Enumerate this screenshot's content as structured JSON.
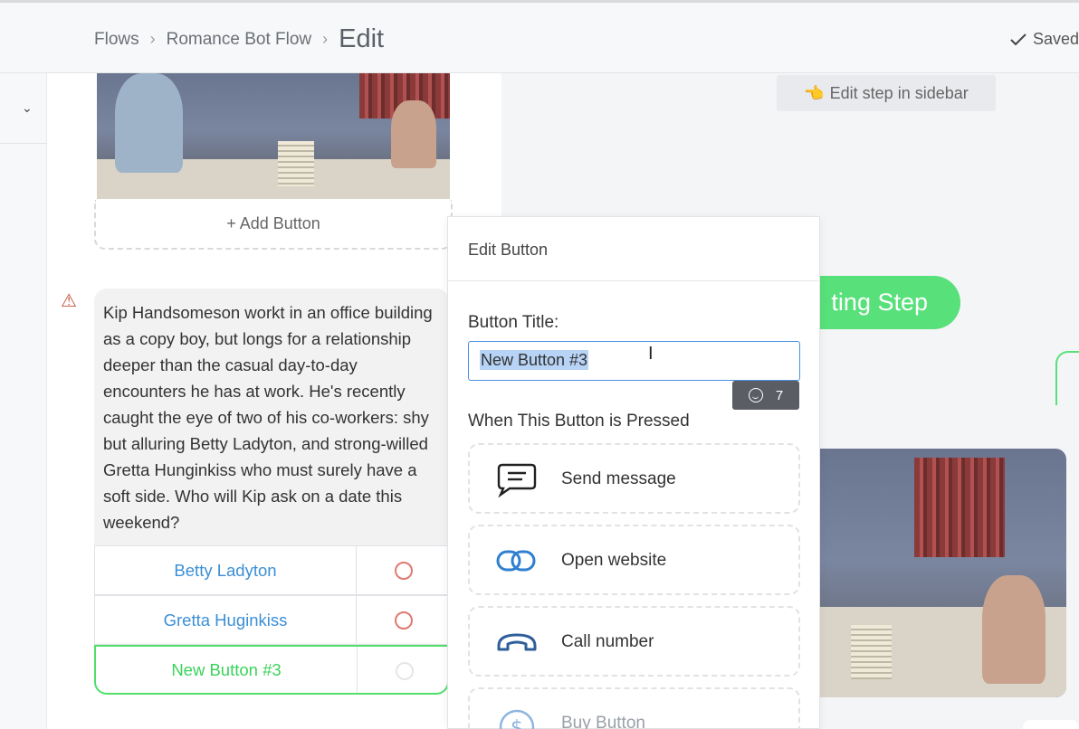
{
  "header": {
    "breadcrumb": [
      "Flows",
      "Romance Bot Flow"
    ],
    "current": "Edit",
    "saved_label": "Saved",
    "sep_glyph": "›"
  },
  "leftnav": {
    "chevron": "⌄"
  },
  "canvas": {
    "add_button_label": "+ Add Button",
    "warning_glyph": "⚠",
    "message_text": "Kip Handsomeson workt in an office building as a copy boy, but longs for a relationship deeper than the casual day-to-day encounters he has at work. He's recently caught the eye of two of his co-workers: shy but alluring Betty Ladyton, and strong-willed Gretta Hunginkiss who must surely have a soft side. Who will Kip ask on a date this weekend?",
    "buttons": [
      {
        "label": "Betty Ladyton"
      },
      {
        "label": "Gretta Huginkiss"
      },
      {
        "label": "New Button #3"
      }
    ]
  },
  "popover": {
    "title": "Edit Button",
    "field_label": "Button Title:",
    "field_value": "New Button #3",
    "cursor_glyph": "I",
    "emoji_count": "7",
    "when_label": "When This Button is Pressed",
    "actions": [
      {
        "label": "Send message",
        "icon": "chat-bubble-icon"
      },
      {
        "label": "Open website",
        "icon": "link-icon"
      },
      {
        "label": "Call number",
        "icon": "phone-icon"
      },
      {
        "label": "Buy Button",
        "icon": "dollar-icon"
      }
    ]
  },
  "right": {
    "hint": "Edit step in sidebar",
    "hint_icon": "👈",
    "pill_label": "ting Step"
  },
  "colors": {
    "accent": "#4a90e2",
    "green": "#58e07a",
    "link": "#3c8fd6",
    "warning": "#c0503c"
  }
}
